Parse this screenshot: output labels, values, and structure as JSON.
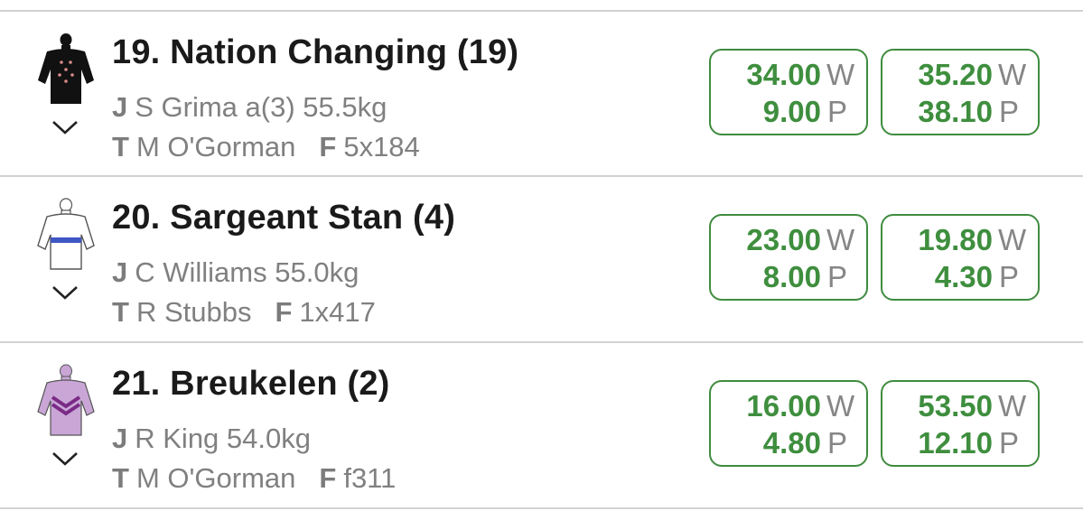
{
  "runners": [
    {
      "name": "19. Nation Changing (19)",
      "jockey_tag": "J",
      "jockey": "S Grima a(3) 55.5kg",
      "trainer_tag": "T",
      "trainer": "M O'Gorman",
      "form_tag": "F",
      "form": "5x184",
      "silk_colors": {
        "body": "#111111",
        "cap": "#111111",
        "spots": "#d98b8b"
      },
      "odds": [
        {
          "win": "34.00",
          "win_label": "W",
          "place": "9.00",
          "place_label": "P"
        },
        {
          "win": "35.20",
          "win_label": "W",
          "place": "38.10",
          "place_label": "P"
        }
      ]
    },
    {
      "name": "20. Sargeant Stan (4)",
      "jockey_tag": "J",
      "jockey": "C Williams 55.0kg",
      "trainer_tag": "T",
      "trainer": "R Stubbs",
      "form_tag": "F",
      "form": "1x417",
      "silk_colors": {
        "body": "#ffffff",
        "cap": "#ffffff",
        "band": "#3f57c4"
      },
      "odds": [
        {
          "win": "23.00",
          "win_label": "W",
          "place": "8.00",
          "place_label": "P"
        },
        {
          "win": "19.80",
          "win_label": "W",
          "place": "4.30",
          "place_label": "P"
        }
      ]
    },
    {
      "name": "21. Breukelen (2)",
      "jockey_tag": "J",
      "jockey": "R King 54.0kg",
      "trainer_tag": "T",
      "trainer": "M O'Gorman",
      "form_tag": "F",
      "form": "f311",
      "silk_colors": {
        "body": "#c9a6d6",
        "cap": "#c9a6d6",
        "chevrons": "#7a2a86"
      },
      "odds": [
        {
          "win": "16.00",
          "win_label": "W",
          "place": "4.80",
          "place_label": "P"
        },
        {
          "win": "53.50",
          "win_label": "W",
          "place": "12.10",
          "place_label": "P"
        }
      ]
    }
  ],
  "colors": {
    "odds_green": "#3e8e3e",
    "divider": "#d2d2d2",
    "label_gray": "#808080"
  }
}
